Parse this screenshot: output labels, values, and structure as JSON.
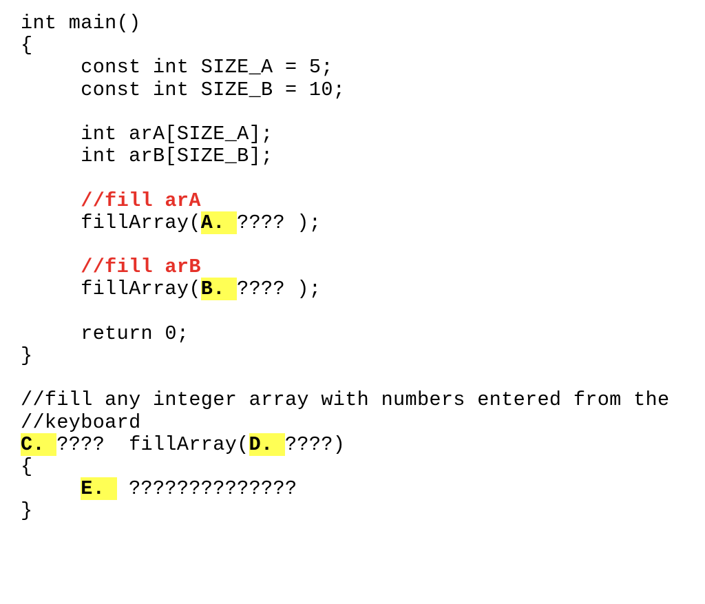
{
  "document": {
    "kind": "code-listing",
    "language": "C++",
    "background_color": "#ffffff",
    "text_color": "#000000",
    "comment_color": "#e5322a",
    "highlight_color": "#ffff55"
  },
  "lines": [
    {
      "id": "line-01",
      "indent": "",
      "segments": [
        {
          "type": "plain",
          "text": "int main()"
        }
      ]
    },
    {
      "id": "line-02",
      "indent": "",
      "segments": [
        {
          "type": "plain",
          "text": "{"
        }
      ]
    },
    {
      "id": "line-03",
      "indent": "",
      "segments": [
        {
          "type": "plain",
          "text": "     const int SIZE_A = 5;"
        }
      ]
    },
    {
      "id": "line-04",
      "indent": "",
      "segments": [
        {
          "type": "plain",
          "text": "     const int SIZE_B = 10;"
        }
      ]
    },
    {
      "id": "line-05",
      "indent": "",
      "segments": [
        {
          "type": "plain",
          "text": ""
        }
      ]
    },
    {
      "id": "line-06",
      "indent": "",
      "segments": [
        {
          "type": "plain",
          "text": "     int arA[SIZE_A];"
        }
      ]
    },
    {
      "id": "line-07",
      "indent": "",
      "segments": [
        {
          "type": "plain",
          "text": "     int arB[SIZE_B];"
        }
      ]
    },
    {
      "id": "line-08",
      "indent": "",
      "segments": [
        {
          "type": "plain",
          "text": ""
        }
      ]
    },
    {
      "id": "line-09",
      "indent": "",
      "segments": [
        {
          "type": "plain",
          "text": "     "
        },
        {
          "type": "comment",
          "text": "//fill arA"
        }
      ]
    },
    {
      "id": "line-10",
      "indent": "",
      "segments": [
        {
          "type": "plain",
          "text": "     fillArray("
        },
        {
          "type": "highlight",
          "text": "A. "
        },
        {
          "type": "plain",
          "text": "???? );"
        }
      ]
    },
    {
      "id": "line-11",
      "indent": "",
      "segments": [
        {
          "type": "plain",
          "text": ""
        }
      ]
    },
    {
      "id": "line-12",
      "indent": "",
      "segments": [
        {
          "type": "plain",
          "text": "     "
        },
        {
          "type": "comment",
          "text": "//fill arB"
        }
      ]
    },
    {
      "id": "line-13",
      "indent": "",
      "segments": [
        {
          "type": "plain",
          "text": "     fillArray("
        },
        {
          "type": "highlight",
          "text": "B. "
        },
        {
          "type": "plain",
          "text": "???? );"
        }
      ]
    },
    {
      "id": "line-14",
      "indent": "",
      "segments": [
        {
          "type": "plain",
          "text": ""
        }
      ]
    },
    {
      "id": "line-15",
      "indent": "",
      "segments": [
        {
          "type": "plain",
          "text": "     return 0;"
        }
      ]
    },
    {
      "id": "line-16",
      "indent": "",
      "segments": [
        {
          "type": "plain",
          "text": "}"
        }
      ]
    },
    {
      "id": "line-17",
      "indent": "",
      "segments": [
        {
          "type": "plain",
          "text": ""
        }
      ]
    },
    {
      "id": "line-18",
      "indent": "",
      "segments": [
        {
          "type": "plain",
          "text": "//fill any integer array with numbers entered from the"
        }
      ]
    },
    {
      "id": "line-19",
      "indent": "",
      "segments": [
        {
          "type": "plain",
          "text": "//keyboard"
        }
      ]
    },
    {
      "id": "line-20",
      "indent": "",
      "segments": [
        {
          "type": "highlight",
          "text": "C. "
        },
        {
          "type": "plain",
          "text": "????  fillArray("
        },
        {
          "type": "highlight",
          "text": "D. "
        },
        {
          "type": "plain",
          "text": "????)"
        }
      ]
    },
    {
      "id": "line-21",
      "indent": "",
      "segments": [
        {
          "type": "plain",
          "text": "{"
        }
      ]
    },
    {
      "id": "line-22",
      "indent": "",
      "segments": [
        {
          "type": "plain",
          "text": "     "
        },
        {
          "type": "highlight",
          "text": "E. "
        },
        {
          "type": "plain",
          "text": " ??????????????"
        }
      ]
    },
    {
      "id": "line-23",
      "indent": "",
      "segments": [
        {
          "type": "plain",
          "text": "}"
        }
      ]
    }
  ],
  "blanks": {
    "labels": [
      "A.",
      "B.",
      "C.",
      "D.",
      "E."
    ]
  }
}
